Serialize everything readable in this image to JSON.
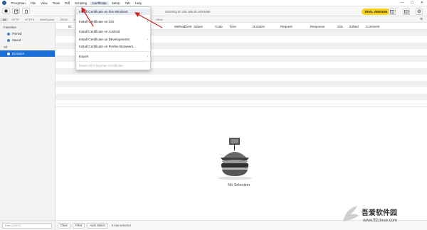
{
  "menubar": {
    "app_name": "Proxyman",
    "items": [
      "File",
      "View",
      "Tools",
      "Diff",
      "Scripting",
      "Certificate",
      "Setup",
      "Tab",
      "Help"
    ],
    "minimize": "—",
    "maximize": "☐",
    "close": "✕"
  },
  "toolbar": {
    "status_text": "Listening on 192.168.26.100:9090",
    "trial_label": "TRIAL VERSION"
  },
  "tabs": {
    "items": [
      "All",
      "HTTP",
      "HTTPS",
      "WebSocket",
      "JSON",
      "XML"
    ],
    "other": "Other"
  },
  "sidebar": {
    "favorites_label": "Favorites",
    "pinned_label": "Pinned",
    "saved_label": "Saved",
    "all_label": "All",
    "domains_label": "Domains",
    "filter_placeholder": "Filter (Ctrl+F)"
  },
  "table": {
    "columns": [
      "ID",
      "URL",
      "Client",
      "Method",
      "Status",
      "Code",
      "Time",
      "Duration",
      "Request",
      "Response",
      "SSL",
      "Edited",
      "Comment"
    ]
  },
  "detail": {
    "empty_label": "No Selection"
  },
  "bottombar": {
    "clear": "Clear",
    "filter": "Filter",
    "auto_select": "Auto Select",
    "status": "0 row selected"
  },
  "dropdown": {
    "items": [
      "Install Certificate on this Windows",
      "Install Certificate on iOS",
      "Install Certificate on Android",
      "Install Certificate on Developments",
      "Install Certificate on Firefox Browsers...",
      "Export",
      "Reset all Proxyman Certificate"
    ]
  },
  "watermark": {
    "chinese": "吾爱软件园",
    "url": "www.52zixue.com"
  },
  "colors": {
    "accent": "#1a6fd6",
    "trial": "#ffd21a",
    "annotation": "#d42020"
  }
}
